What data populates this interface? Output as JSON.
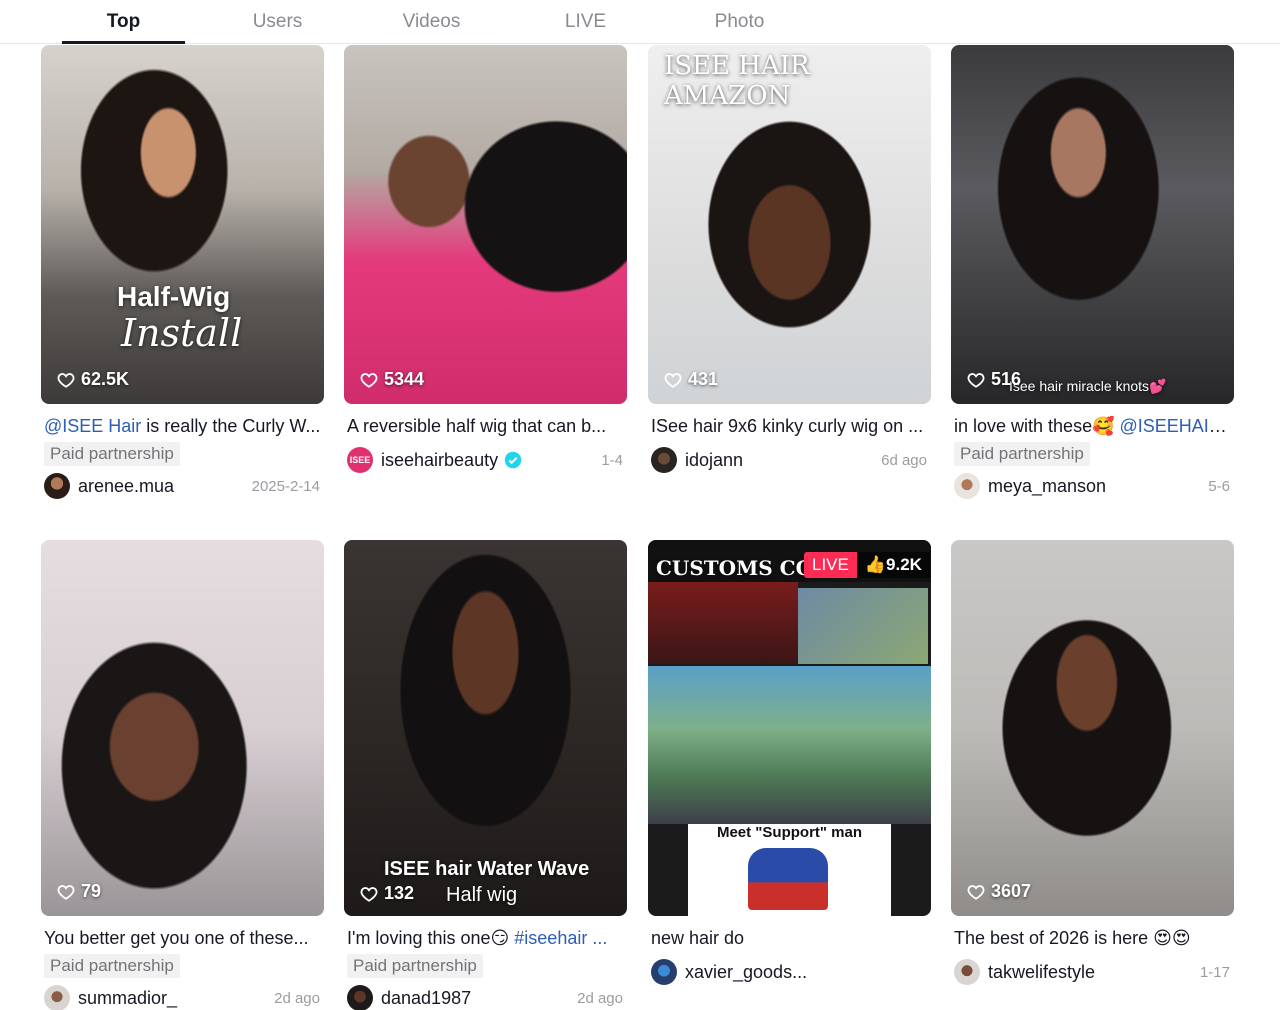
{
  "tabs": [
    {
      "label": "Top",
      "active": true
    },
    {
      "label": "Users",
      "active": false
    },
    {
      "label": "Videos",
      "active": false
    },
    {
      "label": "LIVE",
      "active": false
    },
    {
      "label": "Photo",
      "active": false
    }
  ],
  "icons": {
    "like": "heart-outline-icon",
    "verified": "verified-check-icon"
  },
  "colors": {
    "mention": "#2b5db9",
    "live": "#fe2c55",
    "verified": "#20d5ec"
  },
  "cards": [
    {
      "likes": "62.5K",
      "overlay1": "Half-Wig",
      "overlay2": "Install",
      "caption_mention": "@ISEE Hair",
      "caption_text": " is really the Curly W...",
      "badge": "Paid partnership",
      "author": "arenee.mua",
      "date": "2025-2-14"
    },
    {
      "likes": "5344",
      "caption_text": "A reversible half wig that can b...",
      "author": "iseehairbeauty",
      "avatar_text": "ISEE",
      "date": "1-4"
    },
    {
      "likes": "431",
      "overlay1": "ISEE HAIR AMAZON",
      "caption_text": "ISee hair 9x6 kinky curly wig on ...",
      "author": "idojann",
      "date": "6d ago"
    },
    {
      "likes": "516",
      "overlay1": "Isee hair miracle knots💕",
      "caption_text": "in love with these🥰 ",
      "caption_mention": "@ISEEHAIR...",
      "badge": "Paid partnership",
      "author": "meya_manson",
      "date": "5-6"
    },
    {
      "likes": "79",
      "caption_text": "You better get you one of these...",
      "badge": "Paid partnership",
      "author": "summadior_",
      "date": "2d ago"
    },
    {
      "likes": "132",
      "overlay1": "ISEE hair Water Wave",
      "overlay2": "Half wig",
      "caption_text": "I'm loving this one😏 ",
      "caption_mention": "#iseehair ...",
      "badge": "Paid partnership",
      "author": "danad1987",
      "date": "2d ago"
    },
    {
      "live_label": "LIVE",
      "viewers": "9.2K",
      "overlay1": "CUSTOMS COD",
      "overlay2": "Meet \"Support\" man",
      "caption_text": "new hair do",
      "author": "xavier_goods..."
    },
    {
      "likes": "3607",
      "caption_text": "The best of 2026 is here 😍😍",
      "author": "takwelifestyle",
      "date": "1-17"
    }
  ]
}
